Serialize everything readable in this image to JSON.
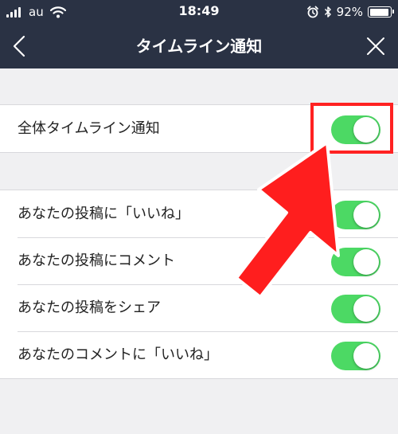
{
  "status_bar": {
    "carrier": "au",
    "time": "18:49",
    "battery_text": "92%",
    "battery_level": 0.92
  },
  "nav": {
    "title": "タイムライン通知"
  },
  "groups": [
    {
      "items": [
        {
          "label": "全体タイムライン通知",
          "on": true
        }
      ]
    },
    {
      "items": [
        {
          "label": "あなたの投稿に「いいね」",
          "on": true
        },
        {
          "label": "あなたの投稿にコメント",
          "on": true
        },
        {
          "label": "あなたの投稿をシェア",
          "on": true
        },
        {
          "label": "あなたのコメントに「いいね」",
          "on": true
        }
      ]
    }
  ],
  "colors": {
    "header_bg": "#2a3244",
    "toggle_on": "#4cd964",
    "annotation": "#ff2222"
  }
}
